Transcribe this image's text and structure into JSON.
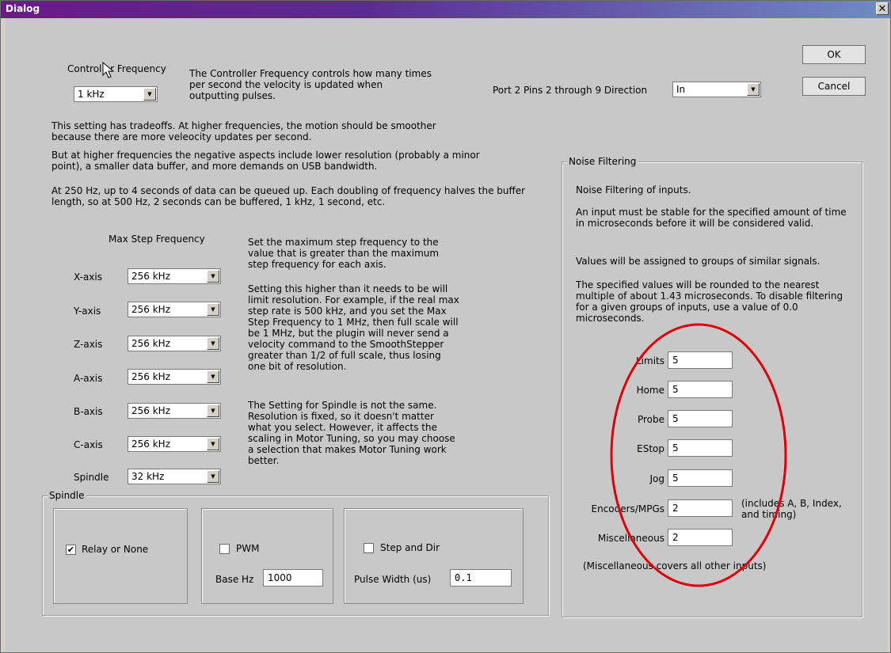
{
  "window": {
    "title": "Dialog",
    "close_glyph": "✕"
  },
  "buttons": {
    "ok": "OK",
    "cancel": "Cancel"
  },
  "controller": {
    "label": "Controller Frequency",
    "value": "1 kHz",
    "description": "The Controller Frequency controls how many times per second the velocity is updated when outputting pulses.",
    "para1": "This setting has tradeoffs.  At higher frequencies, the motion should be smoother because there are more veleocity updates per second.",
    "para2": "But at higher frequencies the negative aspects include lower resolution (probably a minor point), a smaller data buffer, and more demands on USB bandwidth.",
    "para3": "At 250 Hz, up to 4 seconds of data can be queued up.  Each doubling of frequency halves the buffer length, so at 500 Hz, 2 seconds can be buffered, 1 kHz, 1 second, etc."
  },
  "port": {
    "label": "Port 2 Pins 2 through 9 Direction",
    "value": "In"
  },
  "max_step": {
    "heading": "Max Step Frequency",
    "axes": [
      {
        "label": "X-axis",
        "value": "256 kHz"
      },
      {
        "label": "Y-axis",
        "value": "256 kHz"
      },
      {
        "label": "Z-axis",
        "value": "256 kHz"
      },
      {
        "label": "A-axis",
        "value": "256 kHz"
      },
      {
        "label": "B-axis",
        "value": "256 kHz"
      },
      {
        "label": "C-axis",
        "value": "256 kHz"
      },
      {
        "label": "Spindle",
        "value": "32 kHz"
      }
    ],
    "info1": "Set the maximum step frequency to the value that is greater than the maximum step frequency for each axis.",
    "info2": "Setting this higher than it needs to be will limit resolution.  For example, if the real max step rate is 500 kHz, and you set the Max Step Frequency to 1 MHz, then full scale will be 1 MHz, but the plugin will never send a velocity command to the SmoothStepper greater than 1/2 of full scale, thus losing one bit of resolution.",
    "info3": "The Setting for Spindle is not the same. Resolution is fixed, so it doesn't matter what you select.  However, it affects the scaling in Motor Tuning, so you may choose a selection that makes Motor Tuning work better."
  },
  "noise": {
    "group_label": "Noise Filtering",
    "p1": "Noise Filtering of inputs.",
    "p2": "An input must be stable for the specified amount of time in microseconds before it will be considered valid.",
    "p3": "Values will be assigned to groups of similar signals.",
    "p4": "The specified values will be rounded to the nearest multiple of about 1.43 microseconds.  To disable filtering for a given groups of inputs, use a value of 0.0 microseconds.",
    "fields": [
      {
        "label": "Limits",
        "value": "5"
      },
      {
        "label": "Home",
        "value": "5"
      },
      {
        "label": "Probe",
        "value": "5"
      },
      {
        "label": "EStop",
        "value": "5"
      },
      {
        "label": "Jog",
        "value": "5"
      },
      {
        "label": "Encoders/MPGs",
        "value": "2"
      },
      {
        "label": "Miscellaneous",
        "value": "2"
      }
    ],
    "encoders_note": "(includes A, B, Index, and timing)",
    "misc_note": "(Miscellaneous covers all other inputs)",
    "highlight_color": "#e0000b"
  },
  "spindle": {
    "group_label": "Spindle",
    "relay_label": "Relay or None",
    "relay_checked": true,
    "check_glyph": "✔",
    "pwm_label": "PWM",
    "pwm_checked": false,
    "base_hz_label": "Base Hz",
    "base_hz_value": "1000",
    "stepdir_label": "Step and Dir",
    "stepdir_checked": false,
    "pulse_width_label": "Pulse Width (us)",
    "pulse_width_value": "0.1"
  },
  "icons": {
    "combo_arrow": "▼",
    "cursor": "mouse-pointer-icon"
  }
}
